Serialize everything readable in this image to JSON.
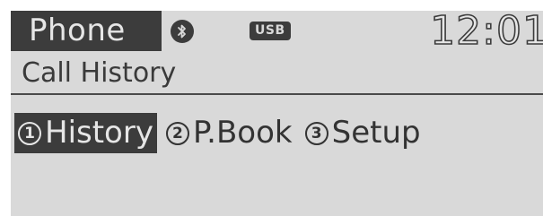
{
  "status_bar": {
    "app_title": "Phone",
    "usb_label": "USB",
    "clock": "12:01"
  },
  "screen": {
    "title": "Call History"
  },
  "menu": {
    "items": [
      {
        "number": "1",
        "label": "History",
        "selected": true
      },
      {
        "number": "2",
        "label": "P.Book",
        "selected": false
      },
      {
        "number": "3",
        "label": "Setup",
        "selected": false
      }
    ]
  },
  "colors": {
    "background": "#d9d9d9",
    "dark": "#3c3c3c",
    "text": "#333333",
    "light_text": "#e6e6e6"
  }
}
